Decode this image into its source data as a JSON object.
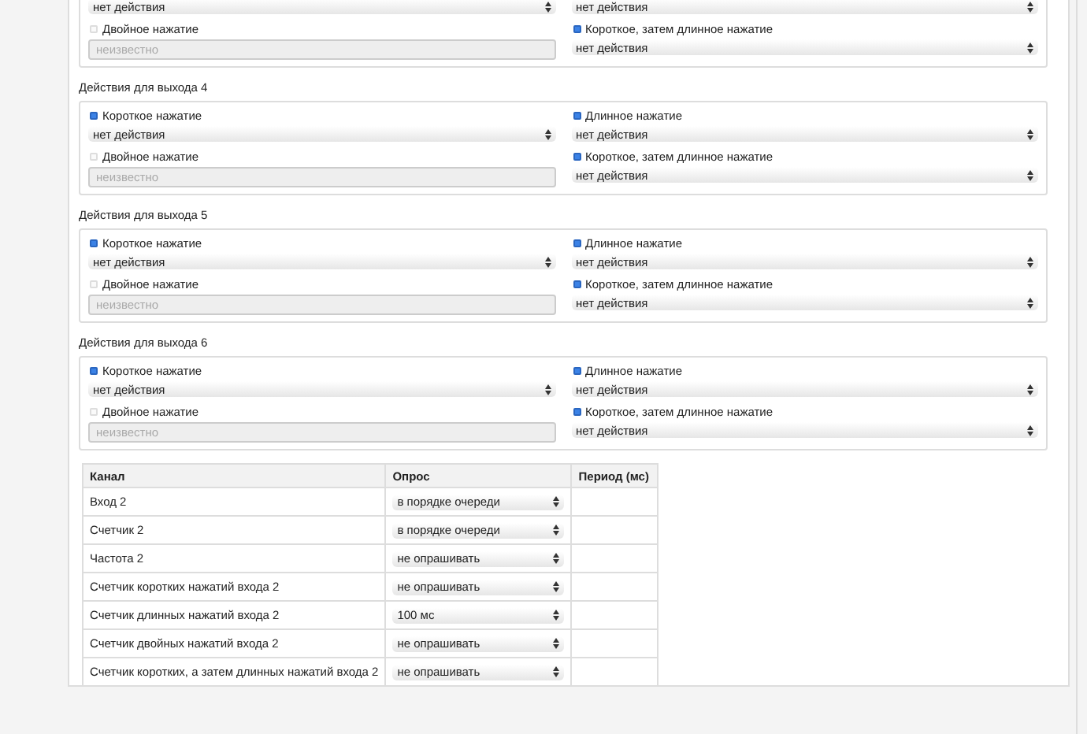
{
  "sections": [
    {
      "fields": [
        {
          "value": "нет действия",
          "disabled": false
        },
        {
          "value": "нет действия",
          "disabled": false
        },
        {
          "label": "Двойное нажатие",
          "checked": false,
          "value": "неизвестно",
          "disabled": true
        },
        {
          "label": "Короткое, затем длинное нажатие",
          "checked": true,
          "value": "нет действия",
          "disabled": false
        }
      ]
    },
    {
      "title": "Действия для выхода 4",
      "fields": [
        {
          "label": "Короткое нажатие",
          "checked": true,
          "value": "нет действия",
          "disabled": false
        },
        {
          "label": "Длинное нажатие",
          "checked": true,
          "value": "нет действия",
          "disabled": false
        },
        {
          "label": "Двойное нажатие",
          "checked": false,
          "value": "неизвестно",
          "disabled": true
        },
        {
          "label": "Короткое, затем длинное нажатие",
          "checked": true,
          "value": "нет действия",
          "disabled": false
        }
      ]
    },
    {
      "title": "Действия для выхода 5",
      "fields": [
        {
          "label": "Короткое нажатие",
          "checked": true,
          "value": "нет действия",
          "disabled": false
        },
        {
          "label": "Длинное нажатие",
          "checked": true,
          "value": "нет действия",
          "disabled": false
        },
        {
          "label": "Двойное нажатие",
          "checked": false,
          "value": "неизвестно",
          "disabled": true
        },
        {
          "label": "Короткое, затем длинное нажатие",
          "checked": true,
          "value": "нет действия",
          "disabled": false
        }
      ]
    },
    {
      "title": "Действия для выхода 6",
      "fields": [
        {
          "label": "Короткое нажатие",
          "checked": true,
          "value": "нет действия",
          "disabled": false
        },
        {
          "label": "Длинное нажатие",
          "checked": true,
          "value": "нет действия",
          "disabled": false
        },
        {
          "label": "Двойное нажатие",
          "checked": false,
          "value": "неизвестно",
          "disabled": true
        },
        {
          "label": "Короткое, затем длинное нажатие",
          "checked": true,
          "value": "нет действия",
          "disabled": false
        }
      ]
    }
  ],
  "table": {
    "columns": [
      "Канал",
      "Опрос",
      "Период (мс)"
    ],
    "rows": [
      {
        "channel": "Вход 2",
        "poll": "в порядке очереди"
      },
      {
        "channel": "Счетчик 2",
        "poll": "в порядке очереди"
      },
      {
        "channel": "Частота 2",
        "poll": "не опрашивать"
      },
      {
        "channel": "Счетчик коротких нажатий входа 2",
        "poll": "не опрашивать"
      },
      {
        "channel": "Счетчик длинных нажатий входа 2",
        "poll": "100 мс"
      },
      {
        "channel": "Счетчик двойных нажатий входа 2",
        "poll": "не опрашивать"
      },
      {
        "channel": "Счетчик коротких, а затем длинных нажатий входа 2",
        "poll": "не опрашивать"
      }
    ]
  }
}
